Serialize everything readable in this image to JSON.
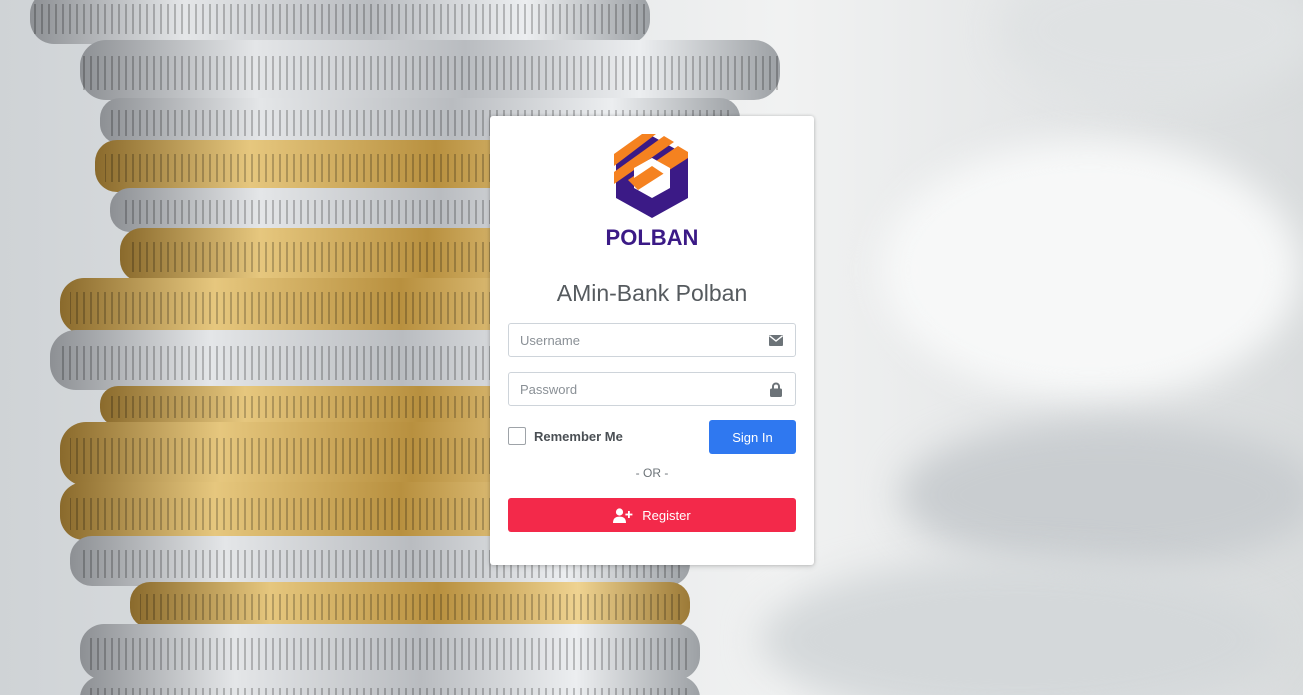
{
  "brand": {
    "logo_text": "POLBAN",
    "logo_colors": {
      "orange": "#f58220",
      "purple": "#3b1a86"
    }
  },
  "login": {
    "title": "AMin-Bank Polban",
    "username_placeholder": "Username",
    "password_placeholder": "Password",
    "remember_label": "Remember Me",
    "signin_label": "Sign In",
    "separator": "- OR -",
    "register_label": "Register"
  },
  "icons": {
    "username": "envelope-icon",
    "password": "lock-icon",
    "register": "user-plus-icon"
  },
  "colors": {
    "signin": "#2f78f0",
    "register": "#f3294a",
    "card": "#ffffff"
  }
}
